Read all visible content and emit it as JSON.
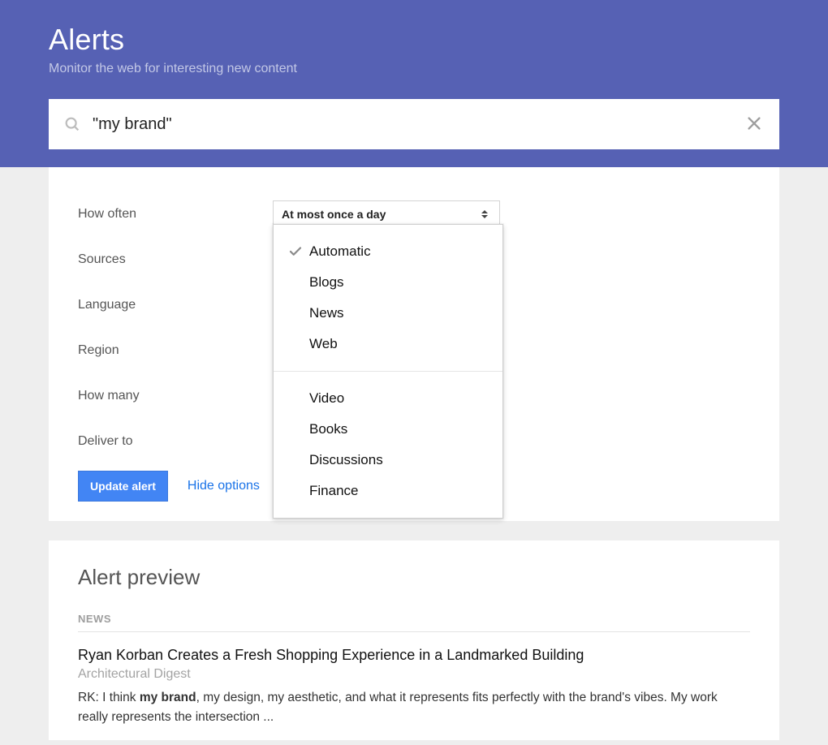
{
  "header": {
    "title": "Alerts",
    "subtitle": "Monitor the web for interesting new content"
  },
  "search": {
    "value": "\"my brand\""
  },
  "options": {
    "labels": {
      "how_often": "How often",
      "sources": "Sources",
      "language": "Language",
      "region": "Region",
      "how_many": "How many",
      "deliver_to": "Deliver to"
    },
    "how_often_value": "At most once a day"
  },
  "sources_menu": {
    "group1": [
      "Automatic",
      "Blogs",
      "News",
      "Web"
    ],
    "group2": [
      "Video",
      "Books",
      "Discussions",
      "Finance"
    ],
    "selected": "Automatic"
  },
  "actions": {
    "update": "Update alert",
    "hide": "Hide options"
  },
  "preview": {
    "heading": "Alert preview",
    "category": "NEWS",
    "article": {
      "title": "Ryan Korban Creates a Fresh Shopping Experience in a Landmarked Building",
      "source": "Architectural Digest",
      "snippet_prefix": "RK: I think ",
      "snippet_bold": "my brand",
      "snippet_suffix": ", my design, my aesthetic, and what it represents fits perfectly with the brand's vibes. My work really represents the intersection ..."
    }
  }
}
